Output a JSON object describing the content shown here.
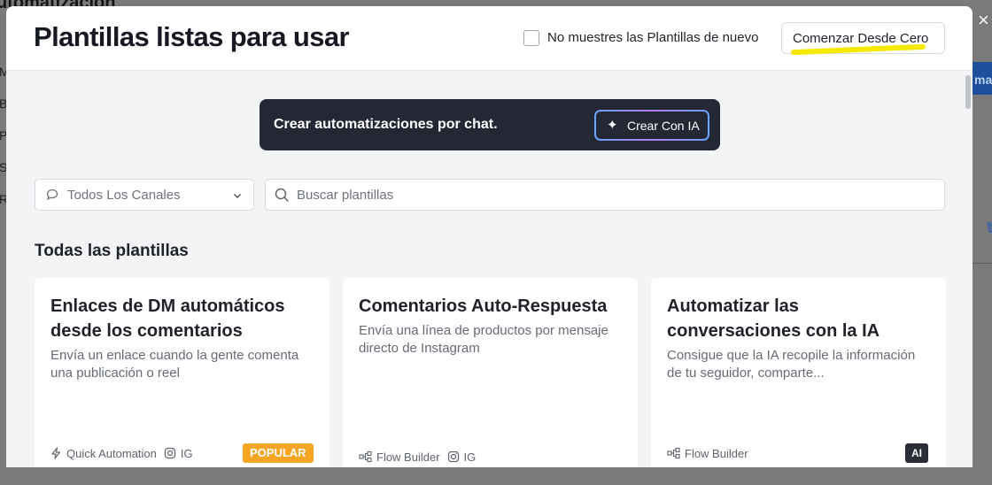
{
  "background": {
    "title": "utomatización",
    "side_letters": [
      "M",
      "B",
      "P",
      "S",
      "R"
    ],
    "right_button_label": "ma",
    "close_glyph": "×"
  },
  "modal": {
    "title": "Plantillas listas para usar",
    "hide_templates": {
      "label": "No muestres las Plantillas de nuevo",
      "checked": false
    },
    "start_scratch_label": "Comenzar Desde Cero",
    "highlight_color": "#f5e900"
  },
  "ai_banner": {
    "text": "Crear automatizaciones por chat.",
    "button_label": "Crear Con IA",
    "button_icon": "sparkle-icon"
  },
  "filters": {
    "channel_select": {
      "value": "Todos Los Canales",
      "icon": "chat-bubble-icon"
    },
    "search": {
      "placeholder": "Buscar plantillas",
      "value": ""
    }
  },
  "section": {
    "title": "Todas las plantillas"
  },
  "templates": [
    {
      "title": "Enlaces de DM automáticos desde los comentarios",
      "description": "Envía un enlace cuando la gente comenta una publicación o reel",
      "builder": "Quick Automation",
      "builder_icon": "lightning-icon",
      "channel": "IG",
      "badge": "POPULAR"
    },
    {
      "title": "Comentarios Auto-Respuesta",
      "description": "Envía una línea de productos por mensaje directo de Instagram",
      "builder": "Flow Builder",
      "builder_icon": "flow-icon",
      "channel": "IG",
      "badge": ""
    },
    {
      "title": "Automatizar las conversaciones con la IA",
      "description": "Consigue que la IA recopile la información de tu seguidor, comparte...",
      "builder": "Flow Builder",
      "builder_icon": "flow-icon",
      "channel": "",
      "badge": "AI"
    }
  ],
  "colors": {
    "banner_bg": "#242835",
    "popular_badge": "#f5a623",
    "ai_badge": "#2a2d35",
    "modal_bg": "#f3f4f6"
  }
}
